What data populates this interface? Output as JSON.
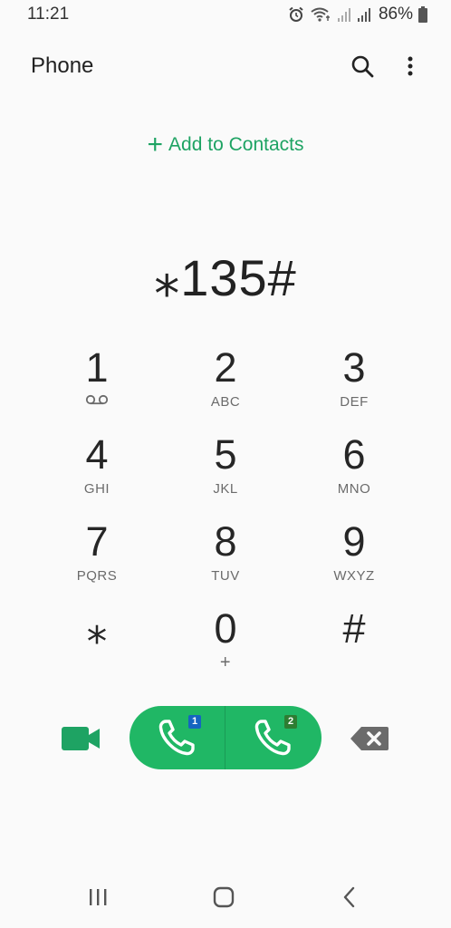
{
  "status_bar": {
    "time": "11:21",
    "battery": "86%",
    "icons": [
      "alarm-icon",
      "wifi-calling-icon",
      "signal-sim1-icon",
      "signal-sim2-icon",
      "battery-icon"
    ]
  },
  "app_bar": {
    "title": "Phone",
    "search_icon": "search-icon",
    "more_icon": "more-vert-icon"
  },
  "add_to_contacts": {
    "icon": "plus",
    "label": "Add to Contacts"
  },
  "dialed_number": "⁎135#",
  "keypad": [
    {
      "digit": "1",
      "letters": "",
      "sub_icon": "voicemail-icon"
    },
    {
      "digit": "2",
      "letters": "ABC"
    },
    {
      "digit": "3",
      "letters": "DEF"
    },
    {
      "digit": "4",
      "letters": "GHI"
    },
    {
      "digit": "5",
      "letters": "JKL"
    },
    {
      "digit": "6",
      "letters": "MNO"
    },
    {
      "digit": "7",
      "letters": "PQRS"
    },
    {
      "digit": "8",
      "letters": "TUV"
    },
    {
      "digit": "9",
      "letters": "WXYZ"
    },
    {
      "digit": "⁎",
      "letters": ""
    },
    {
      "digit": "0",
      "letters": "+"
    },
    {
      "digit": "#",
      "letters": ""
    }
  ],
  "call_row": {
    "video_icon": "video-call-icon",
    "sim1_badge": "1",
    "sim2_badge": "2",
    "sim1_color": "#1565c0",
    "sim2_color": "#2e7d32",
    "call_color": "#20b765",
    "backspace_icon": "backspace-icon"
  },
  "nav_bar": {
    "items": [
      "recent-apps-icon",
      "home-icon",
      "back-icon"
    ]
  },
  "colors": {
    "accent": "#1ea363",
    "background": "#fafafa"
  }
}
